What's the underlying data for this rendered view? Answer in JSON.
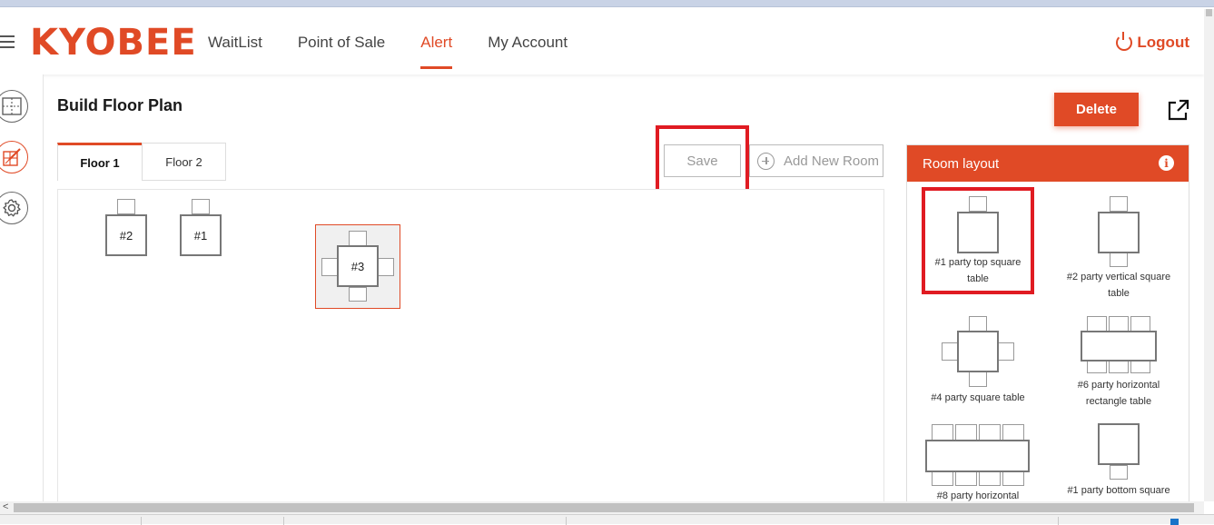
{
  "brand": {
    "logo_text": "KYOBEE",
    "accent": "#e04a26"
  },
  "nav": {
    "items": [
      {
        "label": "WaitList",
        "active": false
      },
      {
        "label": "Point of Sale",
        "active": false
      },
      {
        "label": "Alert",
        "active": true
      },
      {
        "label": "My Account",
        "active": false
      }
    ],
    "logout_label": "Logout"
  },
  "sidebar": {
    "buttons": [
      {
        "icon": "floor-plan-icon",
        "active": false
      },
      {
        "icon": "table-edit-icon",
        "active": true
      },
      {
        "icon": "gear-icon",
        "active": false
      }
    ]
  },
  "page": {
    "title": "Build Floor Plan",
    "delete_label": "Delete",
    "popout_icon": "external-link-icon"
  },
  "floor_tabs": [
    {
      "label": "Floor 1",
      "active": true
    },
    {
      "label": "Floor 2",
      "active": false
    }
  ],
  "toolbar": {
    "save_label": "Save",
    "add_room_label": "Add New Room"
  },
  "canvas_tables": [
    {
      "label": "#2"
    },
    {
      "label": "#1"
    },
    {
      "label": "#3",
      "selected": true
    }
  ],
  "room_layout": {
    "title": "Room layout",
    "info_icon": "i",
    "items": [
      {
        "label": "#1 party top square table",
        "highlighted": true
      },
      {
        "label": "#2 party vertical square table"
      },
      {
        "label": "#4 party square table"
      },
      {
        "label": "#6 party horizontal rectangle table"
      },
      {
        "label": "#8 party horizontal"
      },
      {
        "label": "#1 party bottom square"
      }
    ]
  }
}
